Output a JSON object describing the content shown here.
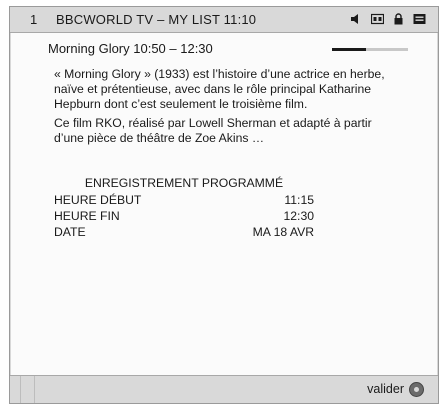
{
  "topbar": {
    "channel_number": "1",
    "title": "BBCWORLD  TV – MY LIST  11:10",
    "icons": [
      "speaker-icon",
      "subtitles-icon",
      "lock-icon",
      "teletext-icon"
    ]
  },
  "program": {
    "line": "Morning  Glory   10:50 – 12:30",
    "progress_fraction": 0.45
  },
  "description": {
    "paragraph1": "« Morning Glory » (1933) est l’histoire d’une actrice en herbe, naïve et prétentieuse, avec dans le rôle principal Katharine Hepburn dont c’est seulement le troisième film.",
    "paragraph2": "Ce film RKO, réalisé par Lowell Sherman et adapté à partir d’une pièce de théâtre de Zoe Akins …"
  },
  "recording": {
    "title": "ENREGISTREMENT PROGRAMMÉ",
    "rows": [
      {
        "label": "HEURE DÉBUT",
        "value": "11:15"
      },
      {
        "label": "HEURE FIN",
        "value": "12:30"
      },
      {
        "label": "DATE",
        "value": "MA 18 AVR"
      }
    ]
  },
  "bottombar": {
    "ok_label": "valider"
  },
  "colors": {
    "bar_background": "#d9d9d9",
    "text": "#1a1a1a"
  }
}
